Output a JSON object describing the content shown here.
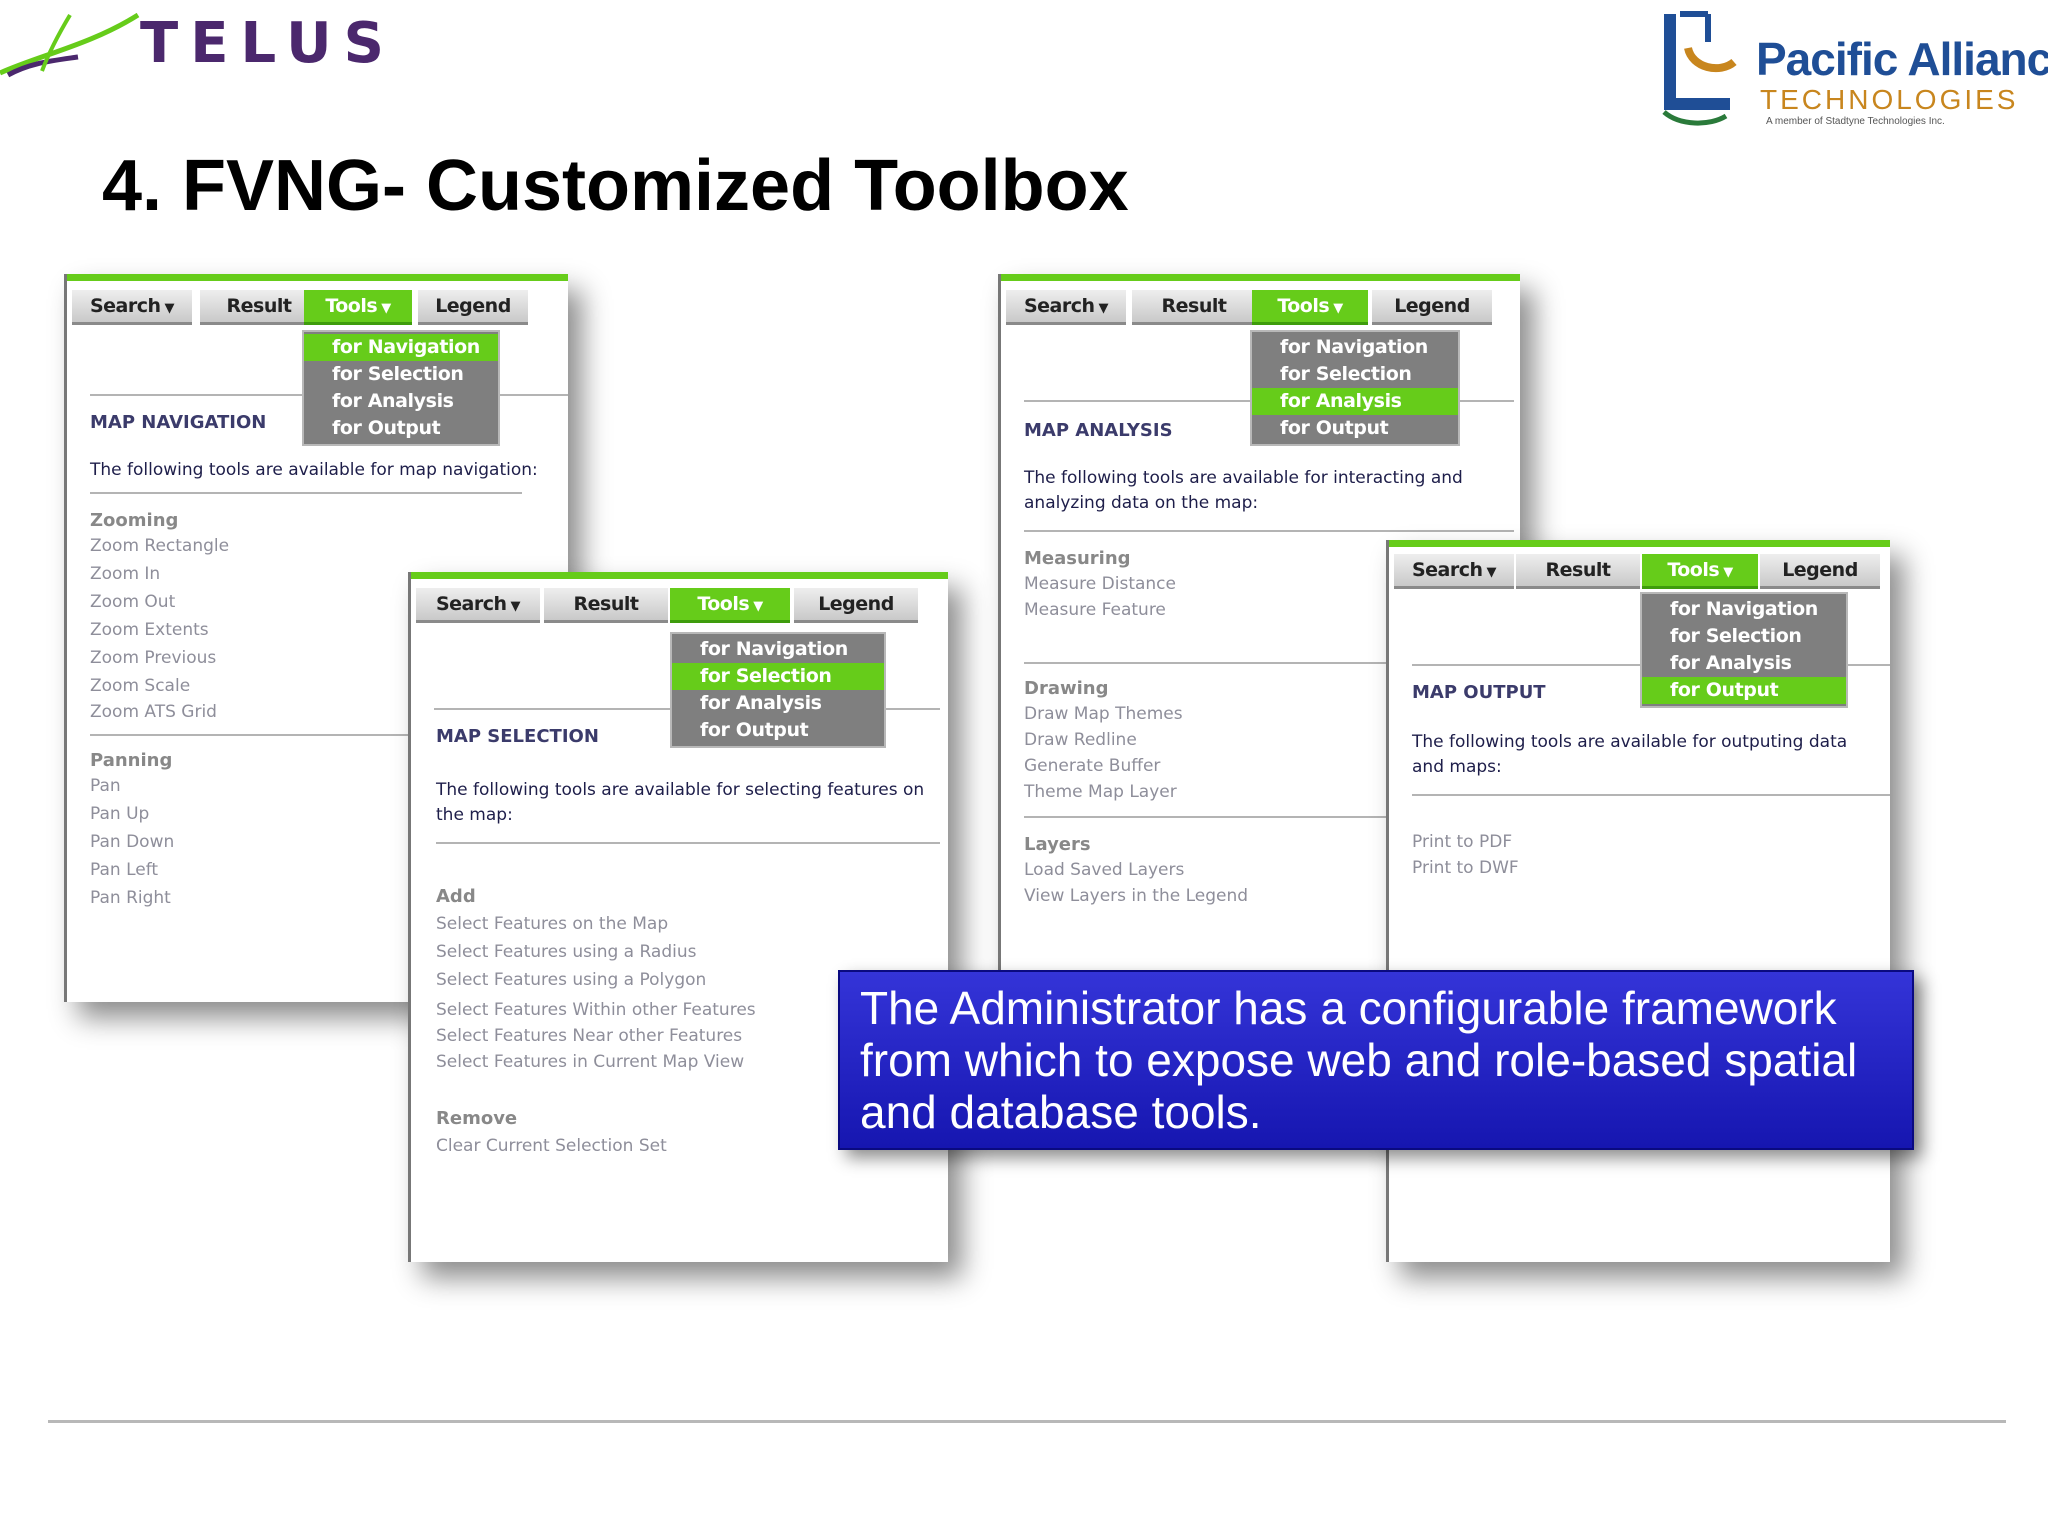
{
  "header": {
    "telus_logo": "TELUS",
    "partner_logo": {
      "name": "Pacific Alliance",
      "sub": "TECHNOLOGIES",
      "member_line": "A member of Stadtyne Technologies Inc."
    }
  },
  "slide_title": "4. FVNG- Customized Toolbox",
  "tabs": {
    "search": "Search",
    "result": "Result",
    "tools": "Tools",
    "legend": "Legend"
  },
  "tools_menu": [
    "for Navigation",
    "for Selection",
    "for Analysis",
    "for Output"
  ],
  "panels": {
    "navigation": {
      "title": "MAP NAVIGATION",
      "desc": "The following tools are available for map navigation:",
      "groups": [
        {
          "name": "Zooming",
          "items": [
            "Zoom Rectangle",
            "Zoom In",
            "Zoom Out",
            "Zoom Extents",
            "Zoom Previous",
            "Zoom Scale",
            "Zoom ATS Grid"
          ]
        },
        {
          "name": "Panning",
          "items": [
            "Pan",
            "Pan Up",
            "Pan Down",
            "Pan Left",
            "Pan Right"
          ]
        }
      ]
    },
    "selection": {
      "title": "MAP SELECTION",
      "desc": "The following tools are available for selecting features on the map:",
      "groups": [
        {
          "name": "Add",
          "items": [
            "Select Features on the Map",
            "Select Features using a Radius",
            "Select Features using a Polygon",
            "Select Features Within other Features",
            "Select Features Near other Features",
            "Select Features in Current Map View"
          ]
        },
        {
          "name": "Remove",
          "items": [
            "Clear Current Selection Set"
          ]
        }
      ]
    },
    "analysis": {
      "title": "MAP ANALYSIS",
      "desc": "The following tools are available for interacting and analyzing data on the map:",
      "groups": [
        {
          "name": "Measuring",
          "items": [
            "Measure Distance",
            "Measure Feature"
          ]
        },
        {
          "name": "Drawing",
          "items": [
            "Draw Map Themes",
            "Draw Redline",
            "Generate Buffer",
            "Theme Map Layer"
          ]
        },
        {
          "name": "Layers",
          "items": [
            "Load Saved Layers",
            "View Layers in the Legend"
          ]
        }
      ]
    },
    "output": {
      "title": "MAP OUTPUT",
      "desc": "The following tools are available for outputing data and maps:",
      "items": [
        "Print to PDF",
        "Print to DWF"
      ]
    }
  },
  "callout": "The Administrator has a configurable framework from which to expose web and role-based spatial and database tools.",
  "colors": {
    "accent_green": "#66cc1a",
    "callout_blue": "#2020c0",
    "telus_purple": "#4b286d"
  }
}
